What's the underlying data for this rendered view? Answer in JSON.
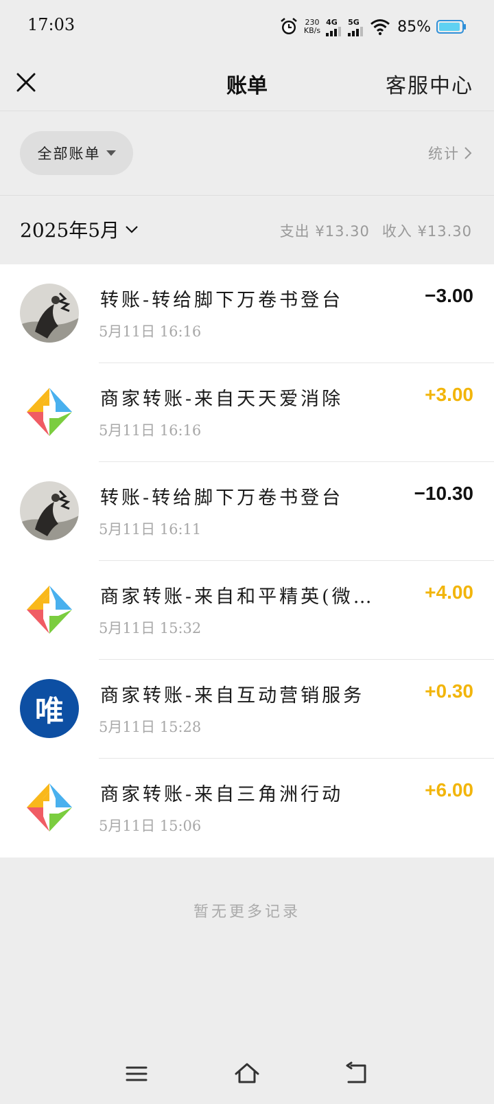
{
  "status_bar": {
    "time": "17:03",
    "net_speed_value": "230",
    "net_speed_unit": "KB/s",
    "sim1": "4G",
    "sim2": "5G",
    "battery": "85%",
    "icons": [
      "alarm-icon",
      "signal-icon",
      "wifi-icon",
      "battery-icon"
    ]
  },
  "header": {
    "title": "账单",
    "help_link": "客服中心",
    "close_icon": "close-icon"
  },
  "filter": {
    "label": "全部账单",
    "stats_label": "统计"
  },
  "month": {
    "label": "2025年5月",
    "expense": "支出 ¥13.30",
    "income": "收入 ¥13.30"
  },
  "transactions": [
    {
      "title": "转账-转给脚下万卷书登台",
      "time": "5月11日 16:16",
      "amount": "−3.00",
      "type": "out",
      "avatar": "photo"
    },
    {
      "title": "商家转账-来自天天爱消除",
      "time": "5月11日 16:16",
      "amount": "+3.00",
      "type": "in",
      "avatar": "game-logo"
    },
    {
      "title": "转账-转给脚下万卷书登台",
      "time": "5月11日 16:11",
      "amount": "−10.30",
      "type": "out",
      "avatar": "photo"
    },
    {
      "title": "商家转账-来自和平精英(微信…",
      "time": "5月11日 15:32",
      "amount": "+4.00",
      "type": "in",
      "avatar": "game-logo"
    },
    {
      "title": "商家转账-来自互动营销服务",
      "time": "5月11日 15:28",
      "amount": "+0.30",
      "type": "in",
      "avatar": "vip-logo",
      "avatar_text": "唯"
    },
    {
      "title": "商家转账-来自三角洲行动",
      "time": "5月11日 15:06",
      "amount": "+6.00",
      "type": "in",
      "avatar": "game-logo"
    }
  ],
  "footer": {
    "no_more": "暂无更多记录"
  },
  "colors": {
    "income": "#f2b50b",
    "expense": "#111111",
    "background": "#ededed",
    "vip_blue": "#0d4fa3"
  }
}
